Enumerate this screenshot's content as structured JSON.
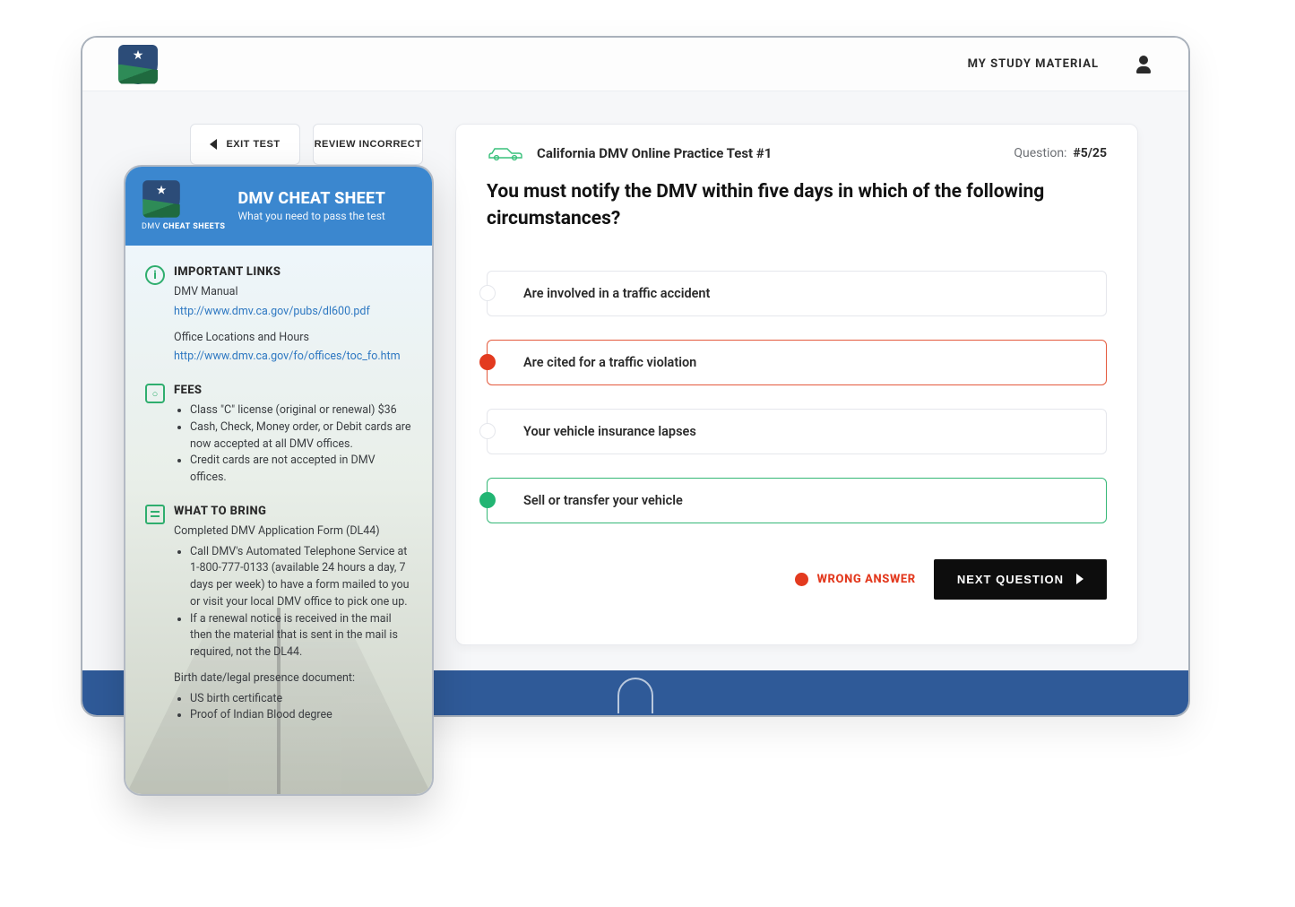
{
  "topbar": {
    "nav_label": "MY STUDY MATERIAL"
  },
  "leftcol": {
    "exit_label": "EXIT TEST",
    "review_label": "REVIEW INCORRECT"
  },
  "quiz": {
    "title": "California DMV Online Practice Test #1",
    "progress_label": "Question:",
    "progress_value": "#5/25",
    "question": "You must notify the DMV within five days in which of the following circumstances?",
    "answers": [
      "Are involved in a traffic accident",
      "Are cited for a traffic violation",
      "Your vehicle insurance lapses",
      "Sell or transfer your vehicle"
    ],
    "wrong_badge": "WRONG ANSWER",
    "next_label": "NEXT QUESTION"
  },
  "mobile": {
    "title": "DMV CHEAT SHEET",
    "subtitle": "What you need to pass the test",
    "brandline_pre": "DMV",
    "brandline_bold": "CHEAT SHEETS",
    "links": {
      "heading": "IMPORTANT LINKS",
      "manual_label": "DMV Manual",
      "manual_url": "http://www.dmv.ca.gov/pubs/dl600.pdf",
      "offices_label": "Office Locations and Hours",
      "offices_url": "http://www.dmv.ca.gov/fo/offices/toc_fo.htm"
    },
    "fees": {
      "heading": "FEES",
      "items": [
        "Class \"C\" license (original or renewal) $36",
        "Cash, Check, Money order, or Debit cards are now accepted at all DMV offices.",
        "Credit cards are not accepted in DMV offices."
      ]
    },
    "bring": {
      "heading": "WHAT TO BRING",
      "intro": "Completed DMV Application Form (DL44)",
      "items": [
        "Call DMV's Automated Telephone Service at 1-800-777-0133 (available 24 hours a day, 7 days per week) to have a form mailed to you or visit your local DMV office to pick one up.",
        "If a renewal notice is received in the mail then the material that is sent in the mail is required, not the DL44."
      ],
      "birth_label": "Birth date/legal presence document:",
      "birth_items": [
        "US birth certificate",
        "Proof of Indian Blood degree"
      ]
    }
  }
}
